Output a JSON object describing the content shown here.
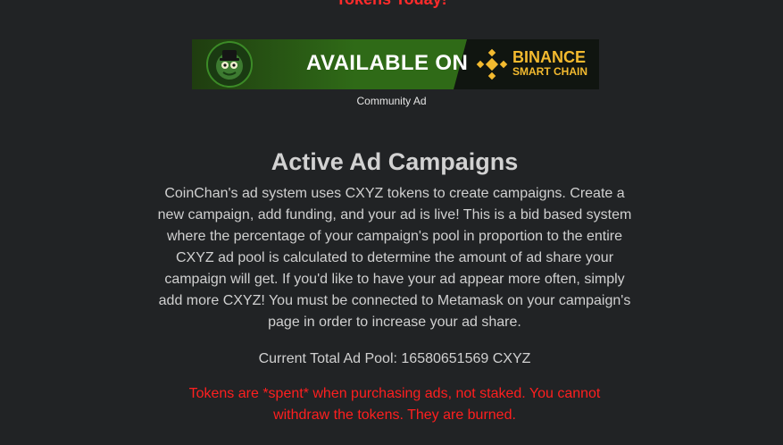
{
  "header": {
    "partial_title": "Tokens Today!"
  },
  "banner": {
    "headline": "AVAILABLE ON",
    "brand": "BINANCE",
    "brand_subtitle": "SMART CHAIN",
    "avatar_icon": "frog-mascot-icon",
    "brand_logo_icon": "binance-logo-icon"
  },
  "ad_label": "Community Ad",
  "campaigns": {
    "title": "Active Ad Campaigns",
    "description": "CoinChan's ad system uses CXYZ tokens to create campaigns. Create a new campaign, add funding, and your ad is live! This is a bid based system where the percentage of your campaign's pool in proportion to the entire CXYZ ad pool is calculated to determine the amount of ad share your campaign will get. If you'd like to have your ad appear more often, simply add more CXYZ! You must be connected to Metamask on your campaign's page in order to increase your ad share.",
    "pool_text": "Current Total Ad Pool: 16580651569 CXYZ",
    "warning": "Tokens are *spent* when purchasing ads, not staked. You cannot withdraw the tokens. They are burned."
  },
  "colors": {
    "background": "#212325",
    "warning": "#ff1f1f",
    "binance": "#f3ba2f",
    "banner_green": "#2f6a17"
  }
}
